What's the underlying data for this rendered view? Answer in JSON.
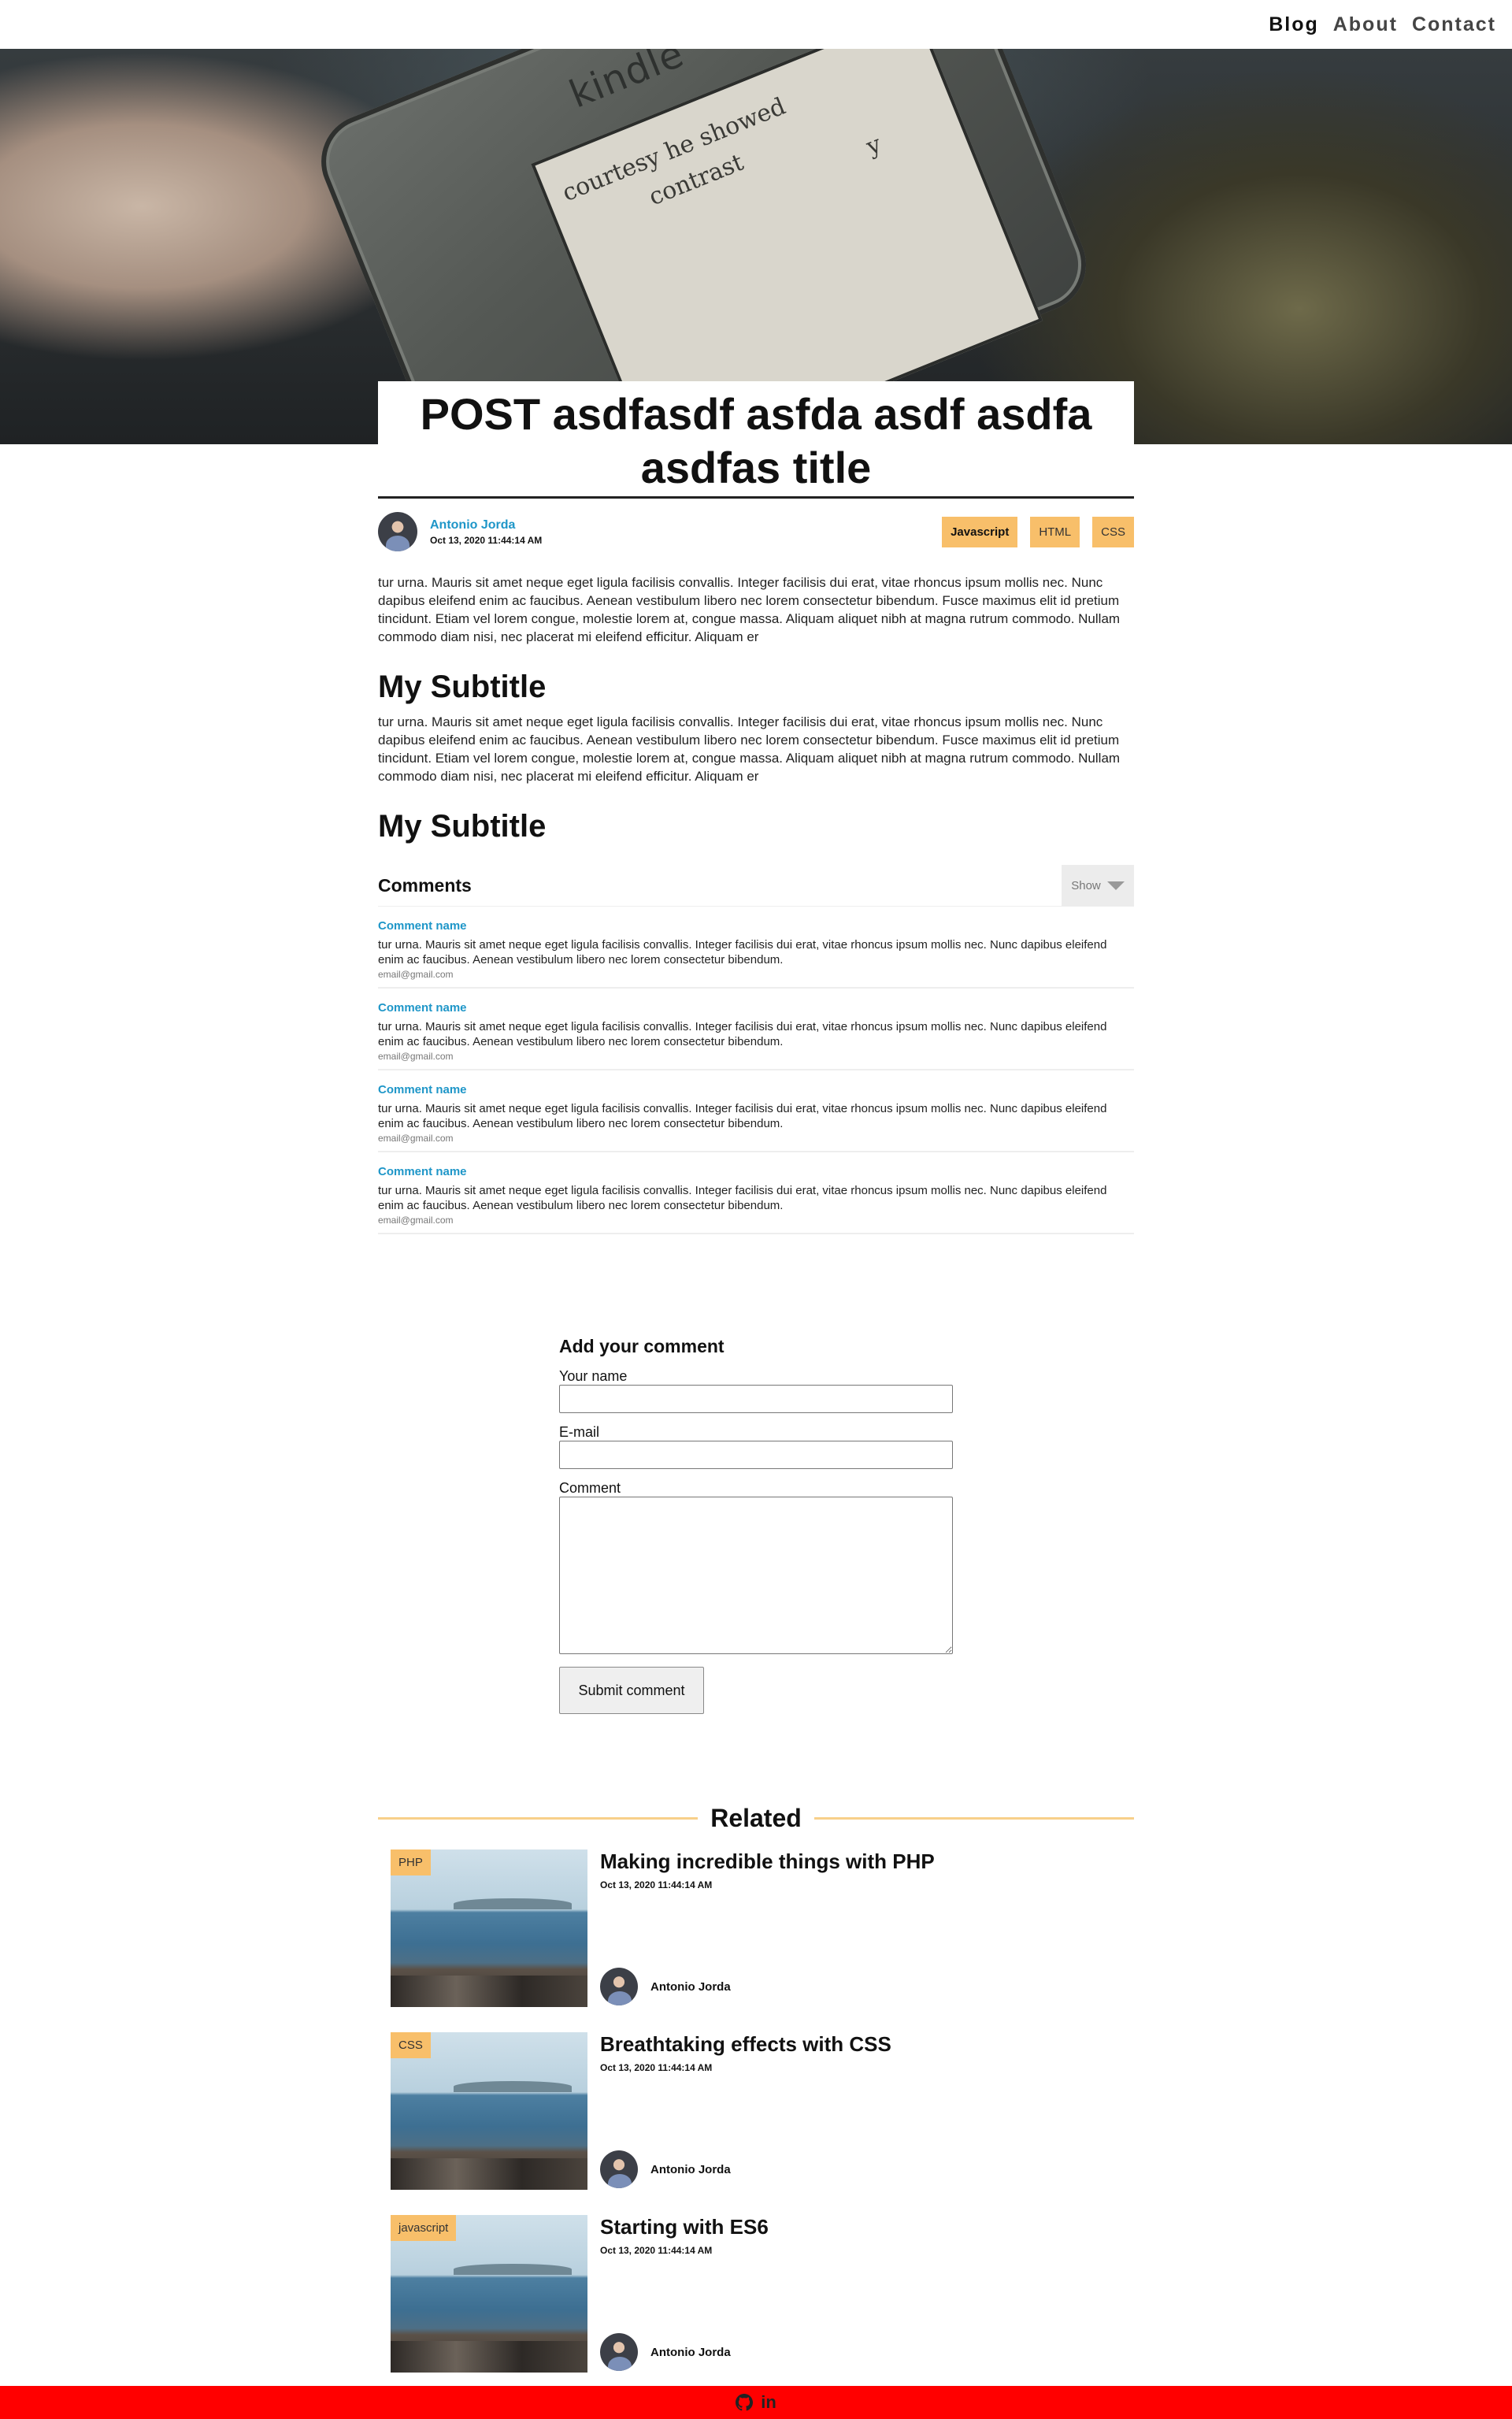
{
  "nav": {
    "items": [
      "Blog",
      "About",
      "Contact"
    ]
  },
  "hero": {
    "device_brand": "kindle",
    "screen_lines": [
      "courtesy he showed",
      "contrast",
      "y"
    ]
  },
  "post": {
    "title": "POST asdfasdf asfda asdf asdfa asdfas title",
    "author": "Antonio Jorda",
    "date": "Oct 13, 2020 11:44:14 AM",
    "tags": [
      "Javascript",
      "HTML",
      "CSS"
    ],
    "body_1": "tur urna. Mauris sit amet neque eget ligula facilisis convallis. Integer facilisis dui erat, vitae rhoncus ipsum mollis nec. Nunc dapibus eleifend enim ac faucibus. Aenean vestibulum libero nec lorem consectetur bibendum. Fusce maximus elit id pretium tincidunt. Etiam vel lorem congue, molestie lorem at, congue massa. Aliquam aliquet nibh at magna rutrum commodo. Nullam commodo diam nisi, nec placerat mi eleifend efficitur. Aliquam er",
    "subtitle_1": "My Subtitle",
    "body_2": "tur urna. Mauris sit amet neque eget ligula facilisis convallis. Integer facilisis dui erat, vitae rhoncus ipsum mollis nec. Nunc dapibus eleifend enim ac faucibus. Aenean vestibulum libero nec lorem consectetur bibendum. Fusce maximus elit id pretium tincidunt. Etiam vel lorem congue, molestie lorem at, congue massa. Aliquam aliquet nibh at magna rutrum commodo. Nullam commodo diam nisi, nec placerat mi eleifend efficitur. Aliquam er",
    "subtitle_2": "My Subtitle"
  },
  "comments": {
    "heading": "Comments",
    "toggle_label": "Show",
    "items": [
      {
        "name": "Comment name",
        "text": "tur urna. Mauris sit amet neque eget ligula facilisis convallis. Integer facilisis dui erat, vitae rhoncus ipsum mollis nec. Nunc dapibus eleifend enim ac faucibus. Aenean vestibulum libero nec lorem consectetur bibendum.",
        "email": "email@gmail.com"
      },
      {
        "name": "Comment name",
        "text": "tur urna. Mauris sit amet neque eget ligula facilisis convallis. Integer facilisis dui erat, vitae rhoncus ipsum mollis nec. Nunc dapibus eleifend enim ac faucibus. Aenean vestibulum libero nec lorem consectetur bibendum.",
        "email": "email@gmail.com"
      },
      {
        "name": "Comment name",
        "text": "tur urna. Mauris sit amet neque eget ligula facilisis convallis. Integer facilisis dui erat, vitae rhoncus ipsum mollis nec. Nunc dapibus eleifend enim ac faucibus. Aenean vestibulum libero nec lorem consectetur bibendum.",
        "email": "email@gmail.com"
      },
      {
        "name": "Comment name",
        "text": "tur urna. Mauris sit amet neque eget ligula facilisis convallis. Integer facilisis dui erat, vitae rhoncus ipsum mollis nec. Nunc dapibus eleifend enim ac faucibus. Aenean vestibulum libero nec lorem consectetur bibendum.",
        "email": "email@gmail.com"
      }
    ]
  },
  "form": {
    "heading": "Add your comment",
    "name_label": "Your name",
    "email_label": "E-mail",
    "comment_label": "Comment",
    "name_value": "",
    "email_value": "",
    "comment_value": "",
    "submit_label": "Submit comment"
  },
  "related": {
    "heading": "Related",
    "items": [
      {
        "badge": "PHP",
        "title": "Making incredible things with PHP",
        "date": "Oct 13, 2020 11:44:14 AM",
        "author": "Antonio Jorda"
      },
      {
        "badge": "CSS",
        "title": "Breathtaking effects with CSS",
        "date": "Oct 13, 2020 11:44:14 AM",
        "author": "Antonio Jorda"
      },
      {
        "badge": "javascript",
        "title": "Starting with ES6",
        "date": "Oct 13, 2020 11:44:14 AM",
        "author": "Antonio Jorda"
      }
    ]
  },
  "footer": {
    "icons": [
      "github-icon",
      "linkedin-icon"
    ],
    "linkedin_text": "in"
  },
  "colors": {
    "accent": "#1e96c8",
    "tag": "#f8bf6a",
    "related_line": "#f8d08a",
    "footer": "#ff0000"
  }
}
